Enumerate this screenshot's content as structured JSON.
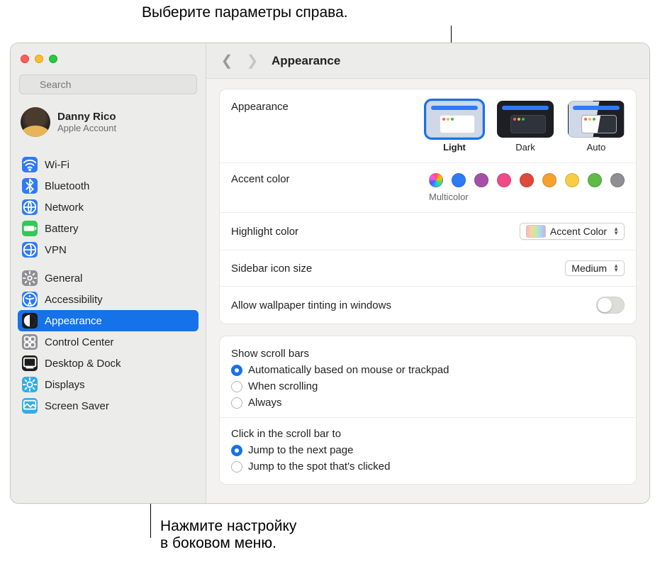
{
  "annotations": {
    "top": "Выберите параметры справа.",
    "bottom": "Нажмите настройку\nв боковом меню."
  },
  "search": {
    "placeholder": "Search"
  },
  "account": {
    "name": "Danny Rico",
    "sub": "Apple Account"
  },
  "sidebar": {
    "group1": [
      {
        "label": "Wi-Fi",
        "bg": "#2f7af7",
        "glyph": "wifi"
      },
      {
        "label": "Bluetooth",
        "bg": "#2f7af7",
        "glyph": "bt"
      },
      {
        "label": "Network",
        "bg": "#2f7af7",
        "glyph": "net"
      },
      {
        "label": "Battery",
        "bg": "#34c759",
        "glyph": "bat"
      },
      {
        "label": "VPN",
        "bg": "#2f7af7",
        "glyph": "vpn"
      }
    ],
    "group2": [
      {
        "label": "General",
        "bg": "#8e8e93",
        "glyph": "gear"
      },
      {
        "label": "Accessibility",
        "bg": "#2f7af7",
        "glyph": "acc"
      },
      {
        "label": "Appearance",
        "bg": "#1c1c1e",
        "glyph": "app",
        "selected": true
      },
      {
        "label": "Control Center",
        "bg": "#8e8e93",
        "glyph": "cc"
      },
      {
        "label": "Desktop & Dock",
        "bg": "#1c1c1e",
        "glyph": "dd"
      },
      {
        "label": "Displays",
        "bg": "#32ade6",
        "glyph": "disp"
      },
      {
        "label": "Screen Saver",
        "bg": "#32ade6",
        "glyph": "ss"
      }
    ]
  },
  "toolbar": {
    "title": "Appearance"
  },
  "appearance": {
    "section_label": "Appearance",
    "options": [
      {
        "label": "Light",
        "kind": "light",
        "selected": true
      },
      {
        "label": "Dark",
        "kind": "dark"
      },
      {
        "label": "Auto",
        "kind": "auto"
      }
    ]
  },
  "accent": {
    "label": "Accent color",
    "selected_caption": "Multicolor",
    "colors": [
      "multi",
      "#2f7af7",
      "#a550a7",
      "#ef4b88",
      "#e0493e",
      "#f6a12f",
      "#f7cd46",
      "#5fba46",
      "#8e8e93"
    ]
  },
  "highlight": {
    "label": "Highlight color",
    "value": "Accent Color"
  },
  "sidebar_icon": {
    "label": "Sidebar icon size",
    "value": "Medium"
  },
  "tinting": {
    "label": "Allow wallpaper tinting in windows",
    "on": false
  },
  "scrollbars": {
    "title": "Show scroll bars",
    "options": [
      {
        "label": "Automatically based on mouse or trackpad",
        "checked": true
      },
      {
        "label": "When scrolling",
        "checked": false
      },
      {
        "label": "Always",
        "checked": false
      }
    ]
  },
  "scrollclick": {
    "title": "Click in the scroll bar to",
    "options": [
      {
        "label": "Jump to the next page",
        "checked": true
      },
      {
        "label": "Jump to the spot that's clicked",
        "checked": false
      }
    ]
  }
}
